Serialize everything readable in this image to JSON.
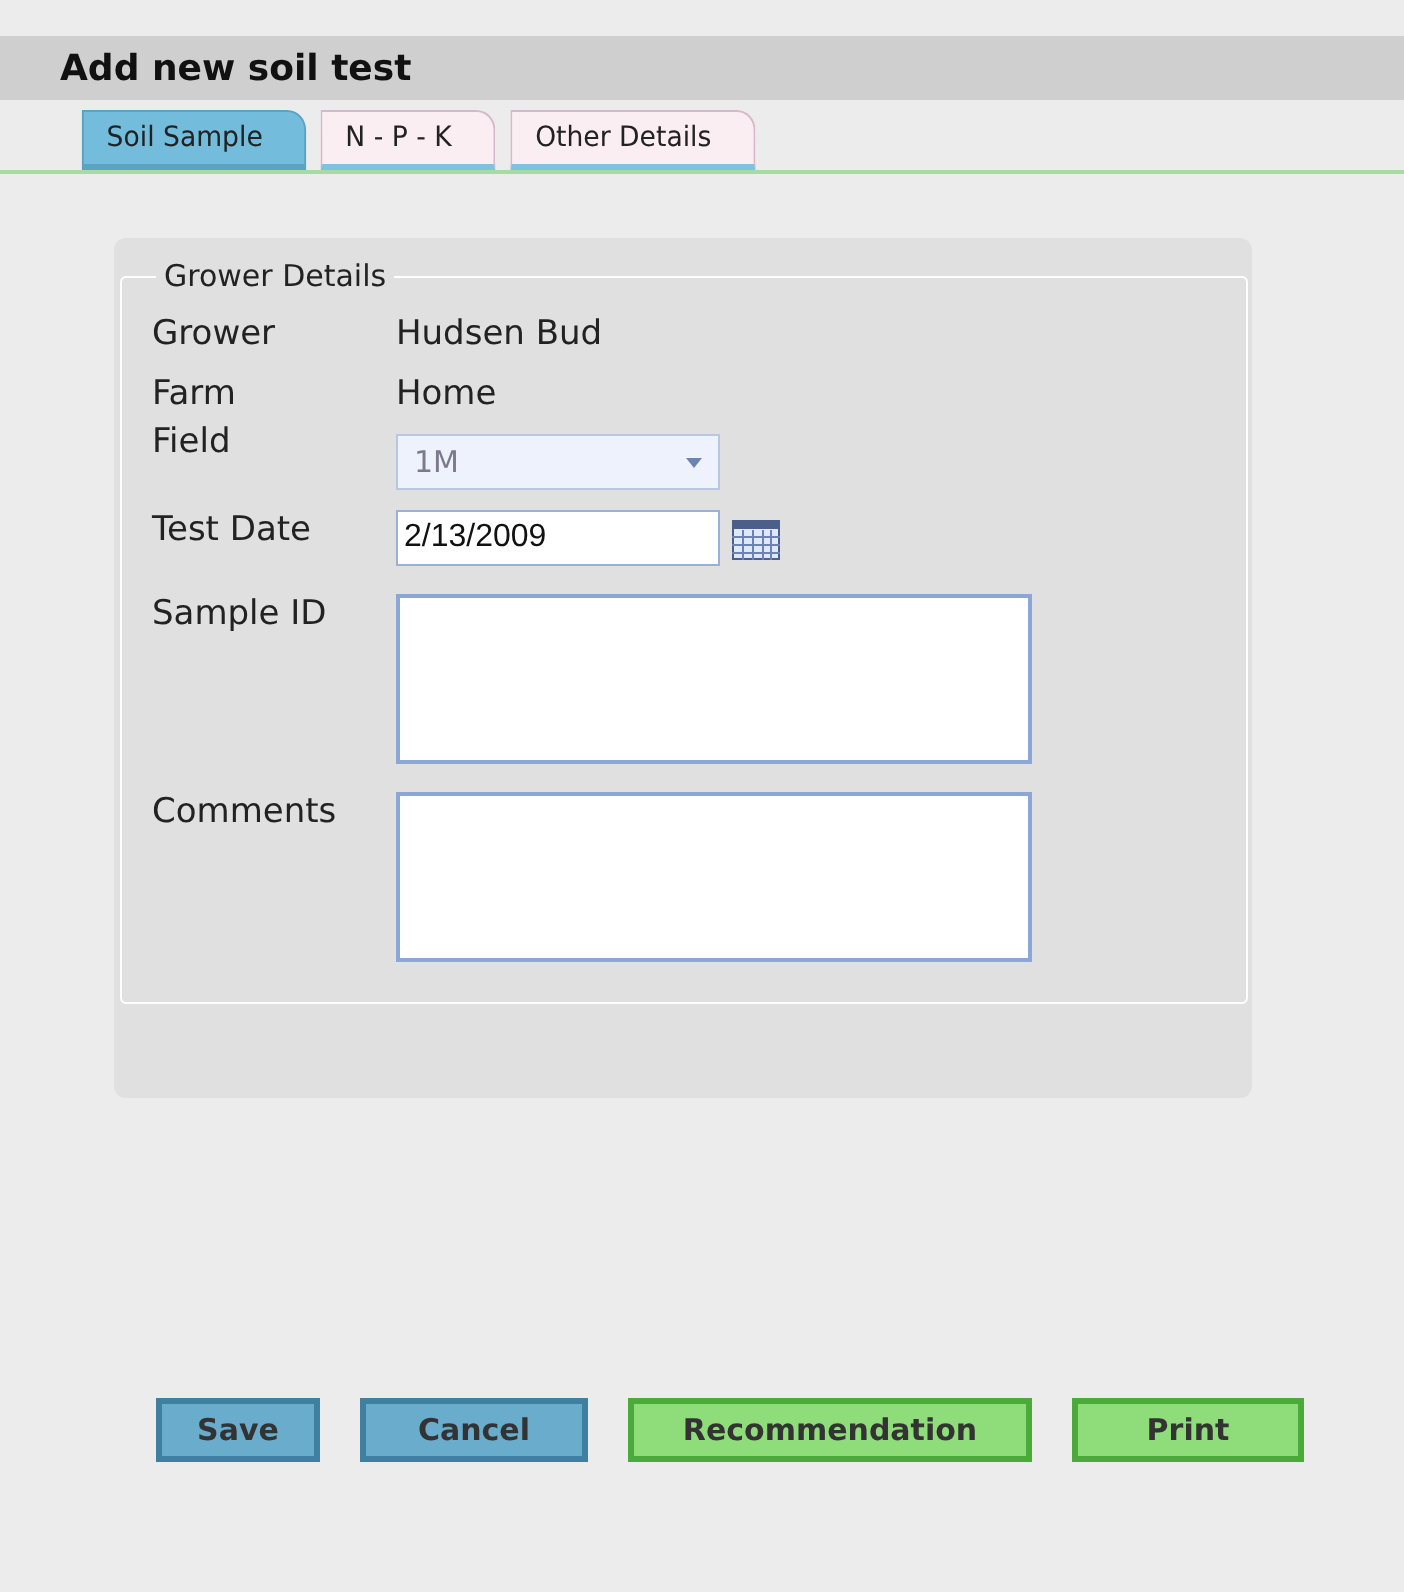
{
  "title": "Add new soil test",
  "tabs": [
    {
      "label": "Soil Sample",
      "selected": true
    },
    {
      "label": "N - P - K",
      "selected": false
    },
    {
      "label": "Other Details",
      "selected": false
    }
  ],
  "fieldset": {
    "legend": "Grower Details",
    "rows": [
      {
        "kind": "text",
        "label": "Grower",
        "value": "Hudsen Bud"
      },
      {
        "kind": "text",
        "label": "Farm",
        "value": "Home"
      },
      {
        "kind": "select",
        "label": "Field",
        "value": "1M",
        "disabled": true
      },
      {
        "kind": "date",
        "label": "Test Date",
        "value": "2/13/2009"
      },
      {
        "kind": "textarea",
        "label": "Sample ID"
      },
      {
        "kind": "textarea",
        "label": "Comments"
      }
    ]
  },
  "buttons": [
    {
      "label": "Save",
      "color": "#6aaccc"
    },
    {
      "label": "Cancel",
      "color": "#6aaccc"
    },
    {
      "label": "Recommendation",
      "color": "#8fdc7a"
    },
    {
      "label": "Print",
      "color": "#8fdc7a"
    }
  ]
}
